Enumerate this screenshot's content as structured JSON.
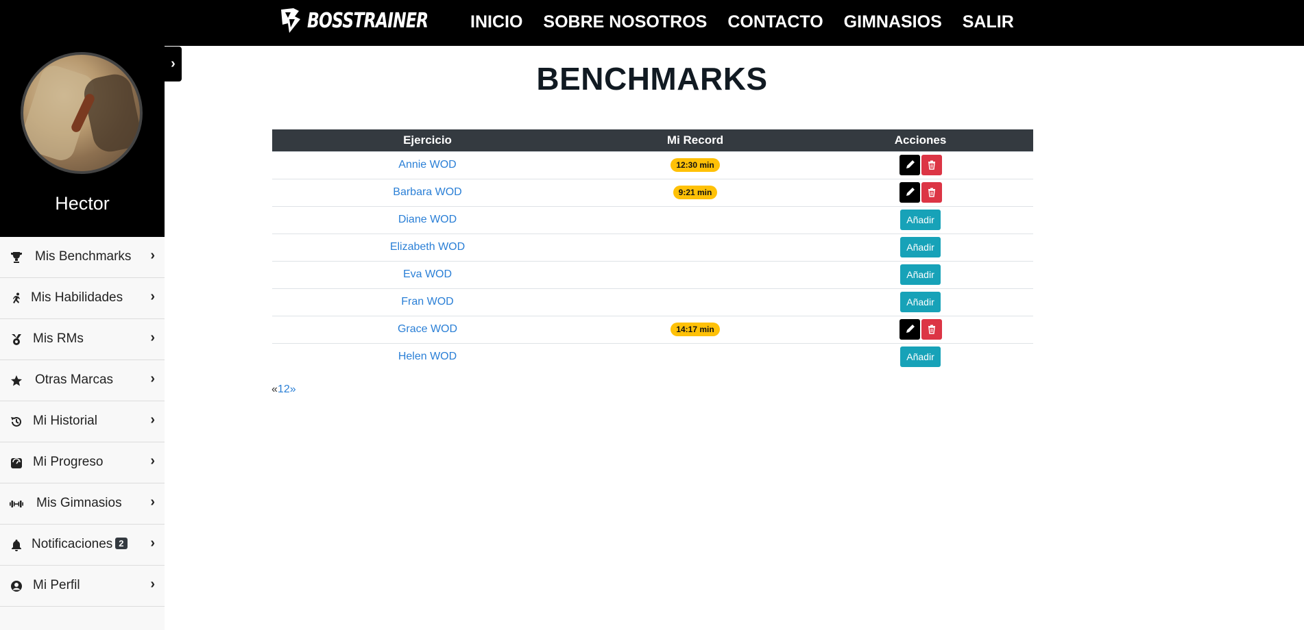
{
  "app": {
    "logo_text": "BOSSTRAINER"
  },
  "nav": {
    "items": [
      "INICIO",
      "SOBRE NOSOTROS",
      "CONTACTO",
      "GIMNASIOS",
      "SALIR"
    ]
  },
  "user": {
    "name": "Hector"
  },
  "sidebar": {
    "items": [
      {
        "label": "Mis Benchmarks",
        "icon": "trophy-icon"
      },
      {
        "label": "Mis Habilidades",
        "icon": "running-icon"
      },
      {
        "label": "Mis RMs",
        "icon": "medal-icon"
      },
      {
        "label": "Otras Marcas",
        "icon": "star-icon"
      },
      {
        "label": "Mi Historial",
        "icon": "history-icon"
      },
      {
        "label": "Mi Progreso",
        "icon": "progress-icon"
      },
      {
        "label": "Mis Gimnasios",
        "icon": "dumbbell-icon"
      },
      {
        "label": "Notificaciones",
        "icon": "bell-icon",
        "badge": "2"
      },
      {
        "label": "Mi Perfil",
        "icon": "user-circle-icon"
      }
    ]
  },
  "page": {
    "title": "BENCHMARKS"
  },
  "table": {
    "headers": [
      "Ejercicio",
      "Mi Record",
      "Acciones"
    ],
    "rows": [
      {
        "name": "Annie WOD",
        "record": "12:30 min"
      },
      {
        "name": "Barbara WOD",
        "record": "9:21 min"
      },
      {
        "name": "Diane WOD",
        "record": ""
      },
      {
        "name": "Elizabeth WOD",
        "record": ""
      },
      {
        "name": "Eva WOD",
        "record": ""
      },
      {
        "name": "Fran WOD",
        "record": ""
      },
      {
        "name": "Grace WOD",
        "record": "14:17 min"
      },
      {
        "name": "Helen WOD",
        "record": ""
      }
    ],
    "add_label": "Añadir"
  },
  "pagination": {
    "prev": "«",
    "pages": [
      "1",
      "2"
    ],
    "next": "»"
  },
  "colors": {
    "accent": "#17a2b8",
    "danger": "#dc3545",
    "warning": "#ffc107",
    "header": "#343a40",
    "link": "#2a7fd6"
  }
}
